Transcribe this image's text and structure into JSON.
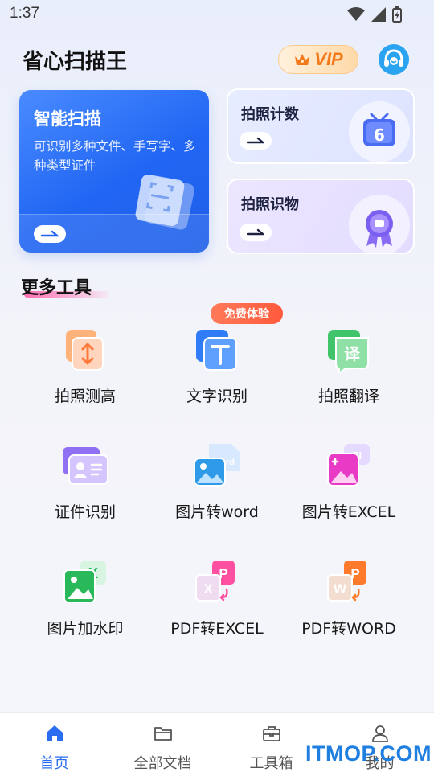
{
  "status": {
    "time": "1:37"
  },
  "header": {
    "app_title": "省心扫描王",
    "vip_label": "VIP"
  },
  "feature_cards": {
    "main": {
      "title": "智能扫描",
      "description": "可识别多种文件、手写字、多种类型证件"
    },
    "count": {
      "title": "拍照计数",
      "badge_number": "6"
    },
    "object": {
      "title": "拍照识物"
    }
  },
  "more_tools": {
    "title": "更多工具",
    "free_badge": "免费体验",
    "items": [
      {
        "label": "拍照测高",
        "icon": "height-measure-icon"
      },
      {
        "label": "文字识别",
        "icon": "text-recognition-icon"
      },
      {
        "label": "拍照翻译",
        "icon": "translate-icon",
        "glyph": "译"
      },
      {
        "label": "证件识别",
        "icon": "id-card-icon"
      },
      {
        "label": "图片转word",
        "icon": "image-to-word-icon",
        "glyph": "Word"
      },
      {
        "label": "图片转EXCEL",
        "icon": "image-to-excel-icon"
      },
      {
        "label": "图片加水印",
        "icon": "image-watermark-icon",
        "glyph": "X"
      },
      {
        "label": "PDF转EXCEL",
        "icon": "pdf-to-excel-icon",
        "glyph_a": "X",
        "glyph_b": "P"
      },
      {
        "label": "PDF转WORD",
        "icon": "pdf-to-word-icon",
        "glyph_a": "W",
        "glyph_b": "P"
      }
    ]
  },
  "bottom_nav": {
    "items": [
      {
        "label": "首页",
        "icon": "home-icon",
        "active": true
      },
      {
        "label": "全部文档",
        "icon": "folder-icon",
        "active": false
      },
      {
        "label": "工具箱",
        "icon": "toolbox-icon",
        "active": false
      },
      {
        "label": "我的",
        "icon": "user-icon",
        "active": false
      }
    ]
  },
  "watermark": "ITMOP.COM",
  "colors": {
    "accent": "#2a6df0",
    "vip_orange": "#f27a1a",
    "free_badge": "#ff5a3c"
  }
}
